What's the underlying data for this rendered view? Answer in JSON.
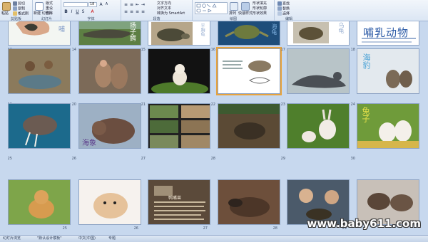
{
  "ribbon": {
    "clipboard": {
      "label": "剪贴板",
      "paste": "粘贴",
      "cut": "剪切",
      "copy": "复制",
      "format_painter": "格式刷"
    },
    "slides": {
      "label": "幻灯片",
      "new_slide": "新建\n幻灯片",
      "layout": "版式",
      "reset": "重设",
      "delete": "删除"
    },
    "font": {
      "label": "字体",
      "font_name": "",
      "font_size": "18"
    },
    "paragraph": {
      "label": "段落",
      "text_direction": "文字方向",
      "align_text": "对齐文本",
      "smartart": "转换为 SmartArt"
    },
    "drawing": {
      "label": "绘图",
      "arrange": "排列",
      "quick_styles": "快速样式",
      "shape_fill": "形状填充",
      "shape_outline": "形状轮廓",
      "shape_effects": "形状效果"
    },
    "editing": {
      "label": "编辑",
      "find": "查找",
      "replace": "替换",
      "select": "选择"
    }
  },
  "slides": [
    {
      "n": "",
      "title": "哺",
      "kind": "hand"
    },
    {
      "n": "",
      "title": "扬子鳄",
      "kind": "croc"
    },
    {
      "n": "",
      "title": "平胸龟",
      "kind": "turtle"
    },
    {
      "n": "",
      "title": "海龟",
      "kind": "seaturtle"
    },
    {
      "n": "",
      "title": "乌龟",
      "kind": "tortoise"
    },
    {
      "n": "",
      "title": "哺乳动物",
      "kind": "title"
    },
    {
      "n": "13",
      "title": "",
      "kind": "monkeys"
    },
    {
      "n": "14",
      "title": "",
      "kind": "monkeys2"
    },
    {
      "n": "15",
      "title": "",
      "kind": "kitten"
    },
    {
      "n": "16",
      "title": "",
      "kind": "mole"
    },
    {
      "n": "17",
      "title": "",
      "kind": "seal"
    },
    {
      "n": "18",
      "title": "海豹",
      "kind": "seals"
    },
    {
      "n": "19",
      "title": "",
      "kind": "walrus"
    },
    {
      "n": "20",
      "title": "海象",
      "kind": "walrus2"
    },
    {
      "n": "21",
      "title": "",
      "kind": "collage"
    },
    {
      "n": "22",
      "title": "",
      "kind": "anteater"
    },
    {
      "n": "23",
      "title": "",
      "kind": "rabbit"
    },
    {
      "n": "24",
      "title": "兔子",
      "kind": "rabbits"
    },
    {
      "n": "25",
      "title": "",
      "kind": "shiba"
    },
    {
      "n": "26",
      "title": "",
      "kind": "puppy"
    },
    {
      "n": "27",
      "title": "鸭嘴兽",
      "kind": "platypus_text"
    },
    {
      "n": "28",
      "title": "",
      "kind": "platypus"
    },
    {
      "n": "29",
      "title": "",
      "kind": "boys"
    },
    {
      "n": "30",
      "title": "",
      "kind": "platypus2"
    }
  ],
  "status": {
    "slide_view": "幻灯片浏览",
    "theme": "\"默认设计模板\"",
    "language": "中文(中国)",
    "macro": "专题"
  },
  "watermark": "www.baby611.com",
  "colors": {
    "selected": "#e8a33c",
    "ribbon": "#dbe6f4",
    "background": "#c7d8ee"
  }
}
